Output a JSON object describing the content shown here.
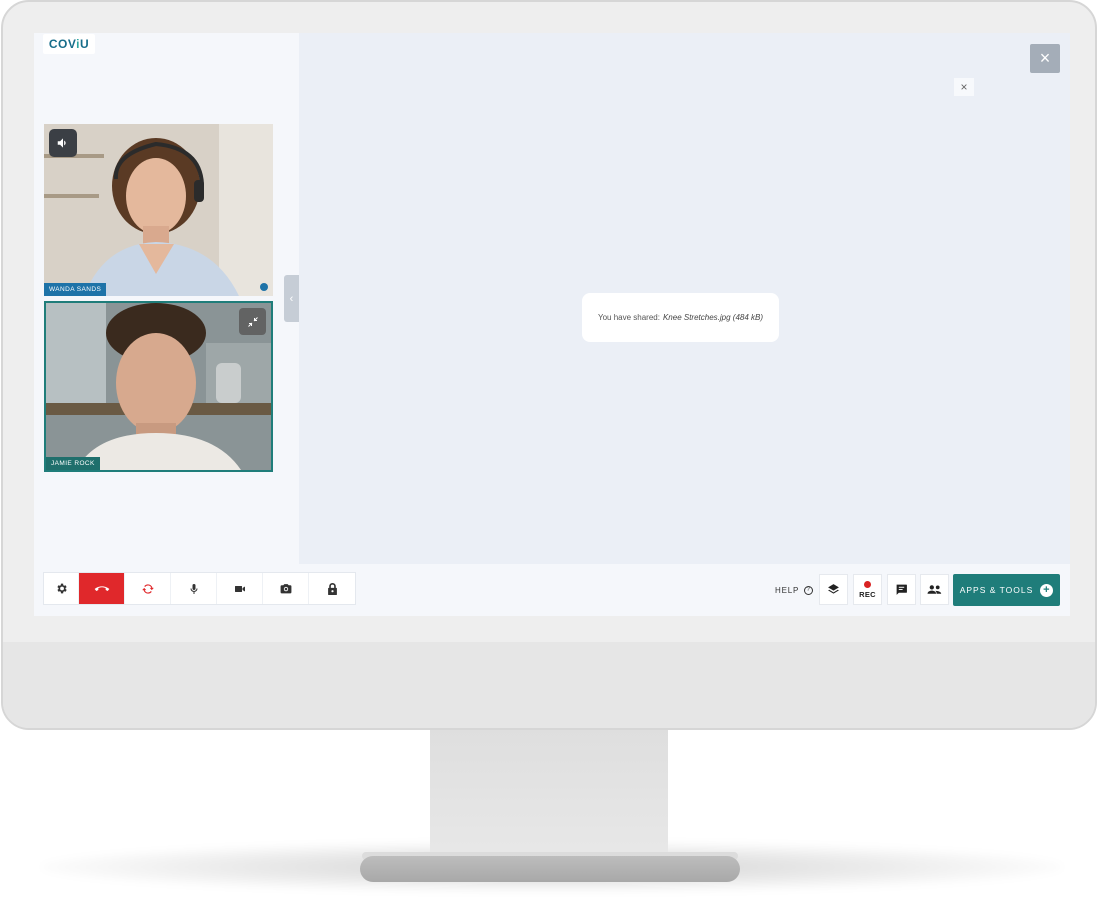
{
  "app": {
    "logo": {
      "part1": "CO",
      "part2": "V",
      "part3": "i",
      "part4": "U"
    }
  },
  "stage": {
    "shared_prefix": "You have shared:",
    "shared_file": "Knee Stretches.jpg (484 kB)",
    "close_main_icon": "×",
    "close_small_icon": "×"
  },
  "participants": [
    {
      "name": "WANDA SANDS"
    },
    {
      "name": "JAMIE ROCK"
    }
  ],
  "toolbar": {
    "left_buttons": [
      "settings-icon",
      "end-call-icon",
      "switch-camera-icon",
      "microphone-icon",
      "video-camera-icon",
      "screenshot-camera-icon",
      "lock-icon"
    ],
    "help_label": "HELP",
    "help_icon": "?",
    "rec_label": "REC",
    "apps_label": "APPS & TOOLS",
    "apps_plus": "+"
  },
  "colors": {
    "accent_teal": "#1f7d7a",
    "accent_blue": "#1e73a8",
    "end_call_red": "#e0282b",
    "rec_red": "#d92222"
  }
}
